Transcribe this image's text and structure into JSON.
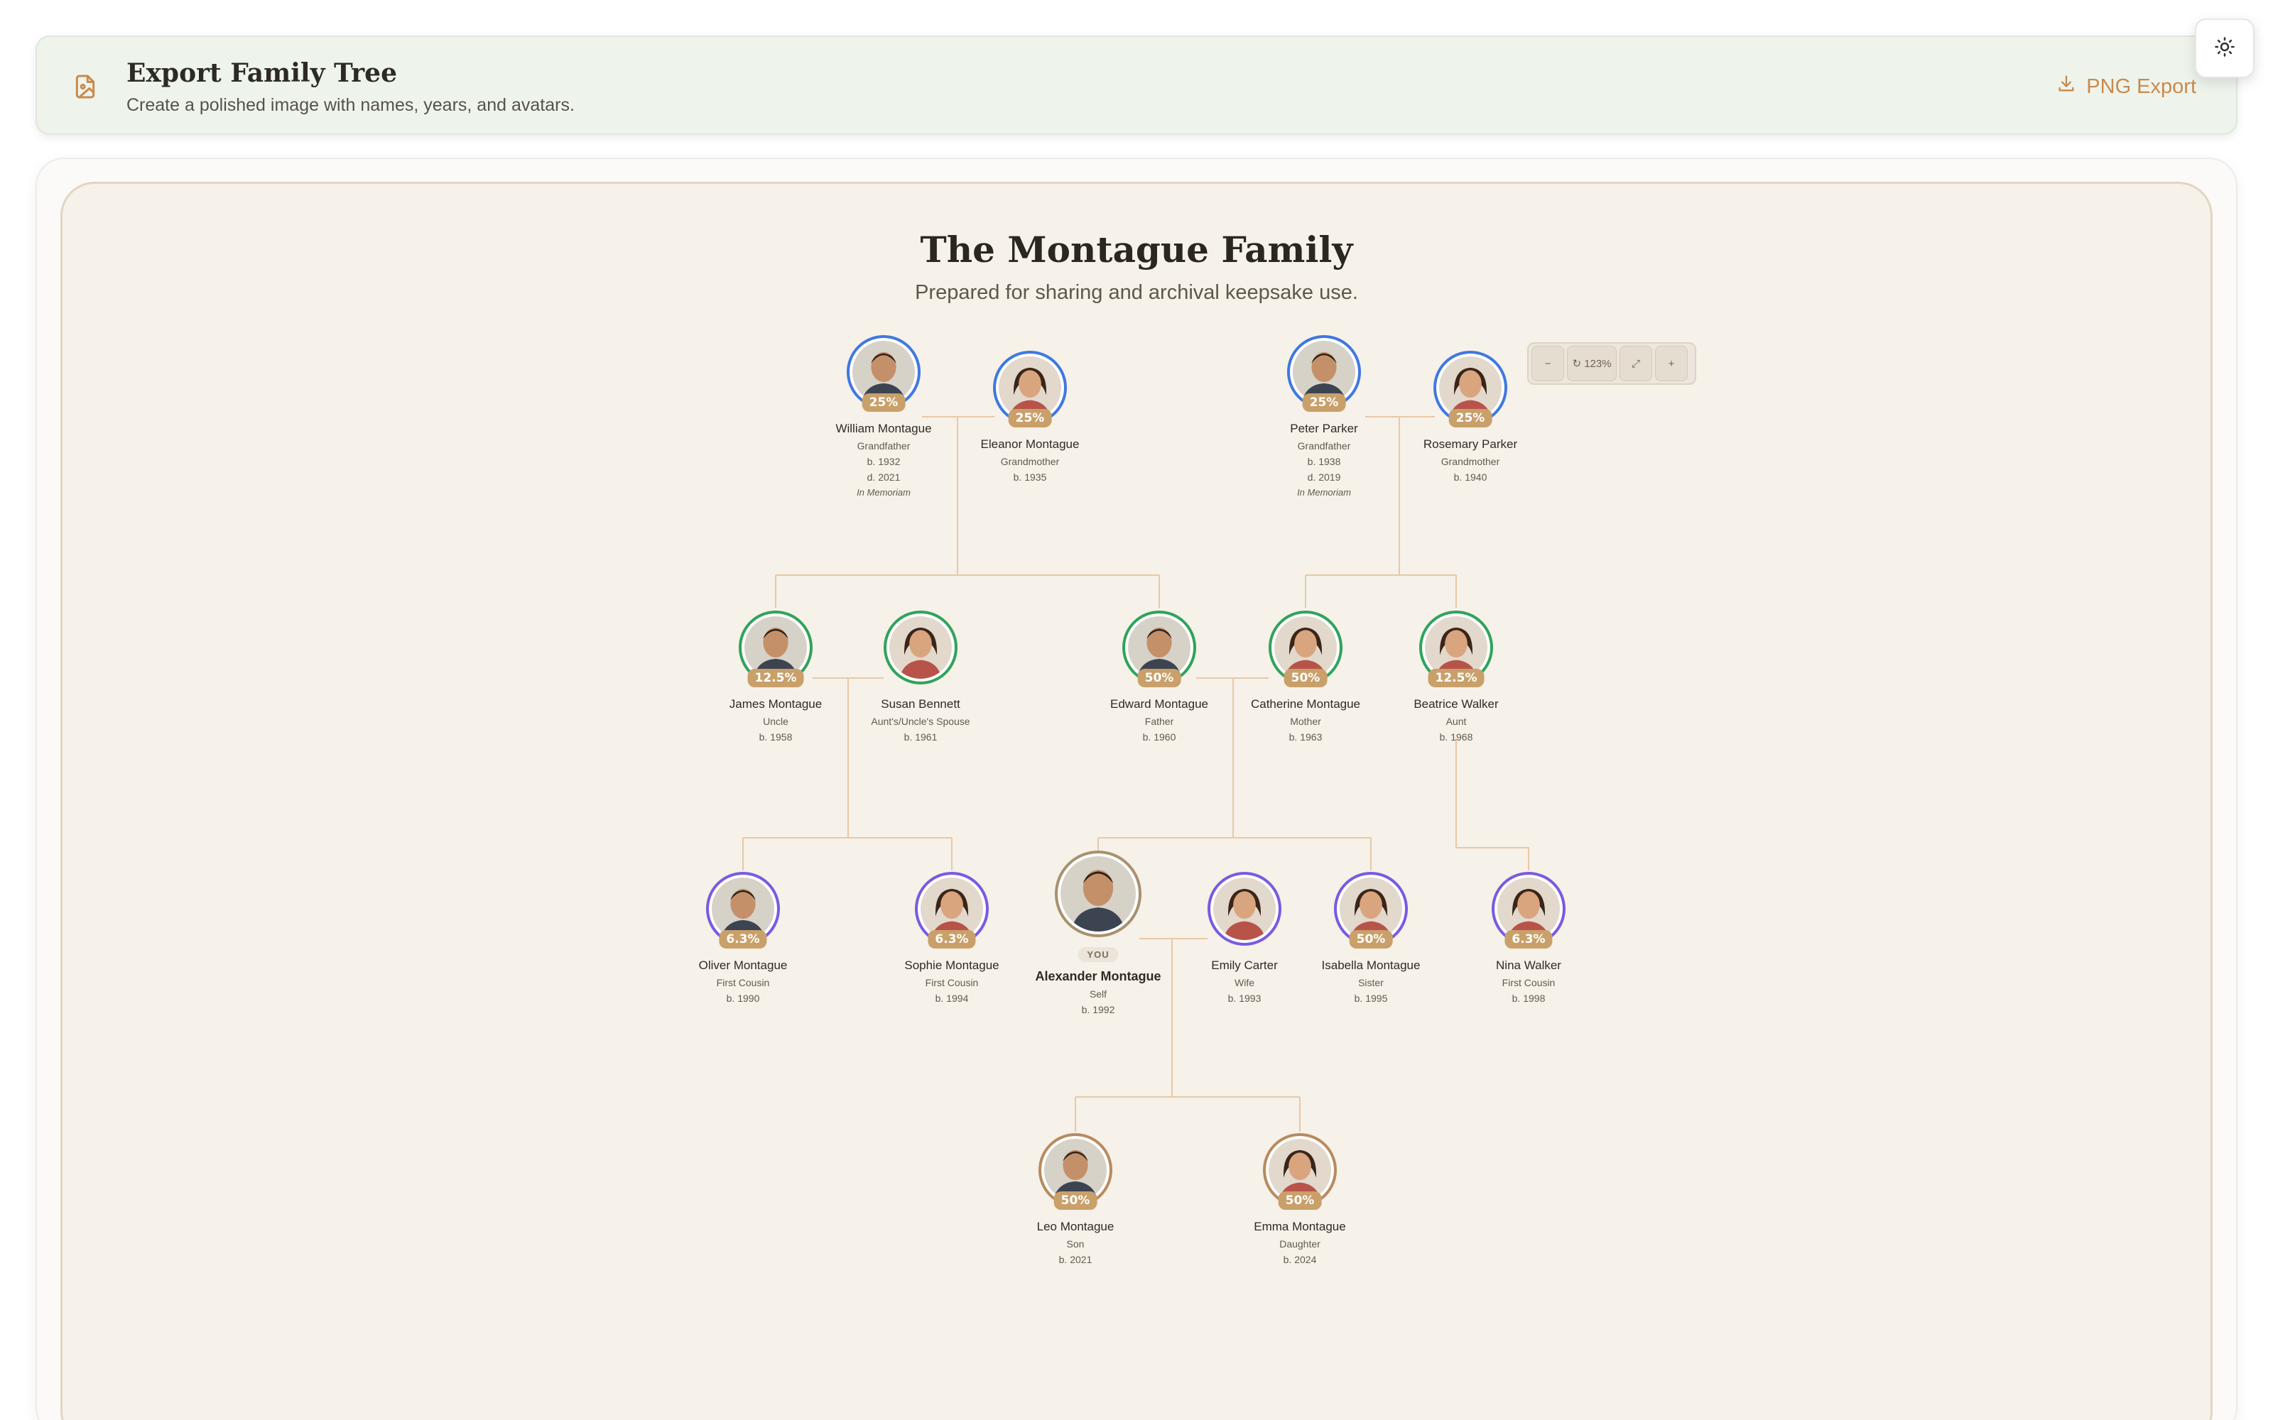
{
  "header": {
    "title": "Export Family Tree",
    "subtitle": "Create a polished image with names, years, and avatars.",
    "export_label": "PNG Export"
  },
  "tree": {
    "title": "The Montague Family",
    "subtitle": "Prepared for sharing and archival keepsake use."
  },
  "zoom": {
    "level": "123%"
  },
  "colors": {
    "accent": "#c98a4c",
    "grandparent_ring": "#3f78e0",
    "parent_gen_ring": "#2fa35c",
    "cousin_gen_ring": "#7a5ae0",
    "descendant_ring": "#b88a5e",
    "badge": "#c9a06a"
  },
  "people": [
    {
      "name": "William Montague",
      "role": "Grandfather",
      "born": "b. 1932",
      "died": "d. 2021",
      "memorial": "In Memoriam",
      "relation": "25%"
    },
    {
      "name": "Eleanor Montague",
      "role": "Grandmother",
      "born": "b. 1935",
      "relation": "25%"
    },
    {
      "name": "Peter Parker",
      "role": "Grandfather",
      "born": "b. 1938",
      "died": "d. 2019",
      "memorial": "In Memoriam",
      "relation": "25%"
    },
    {
      "name": "Rosemary Parker",
      "role": "Grandmother",
      "born": "b. 1940",
      "relation": "25%"
    },
    {
      "name": "James Montague",
      "role": "Uncle",
      "born": "b. 1958",
      "relation": "12.5%"
    },
    {
      "name": "Susan Bennett",
      "role": "Aunt's/Uncle's Spouse",
      "born": "b. 1961"
    },
    {
      "name": "Edward Montague",
      "role": "Father",
      "born": "b. 1960",
      "relation": "50%"
    },
    {
      "name": "Catherine Montague",
      "role": "Mother",
      "born": "b. 1963",
      "relation": "50%"
    },
    {
      "name": "Beatrice Walker",
      "role": "Aunt",
      "born": "b. 1968",
      "relation": "12.5%"
    },
    {
      "name": "Oliver Montague",
      "role": "First Cousin",
      "born": "b. 1990",
      "relation": "6.3%"
    },
    {
      "name": "Sophie Montague",
      "role": "First Cousin",
      "born": "b. 1994",
      "relation": "6.3%"
    },
    {
      "name": "Alexander Montague",
      "role": "Self",
      "born": "b. 1992",
      "you": "YOU"
    },
    {
      "name": "Emily Carter",
      "role": "Wife",
      "born": "b. 1993"
    },
    {
      "name": "Isabella Montague",
      "role": "Sister",
      "born": "b. 1995",
      "relation": "50%"
    },
    {
      "name": "Nina Walker",
      "role": "First Cousin",
      "born": "b. 1998",
      "relation": "6.3%"
    },
    {
      "name": "Leo Montague",
      "role": "Son",
      "born": "b. 2021",
      "relation": "50%"
    },
    {
      "name": "Emma Montague",
      "role": "Daughter",
      "born": "b. 2024",
      "relation": "50%"
    }
  ]
}
